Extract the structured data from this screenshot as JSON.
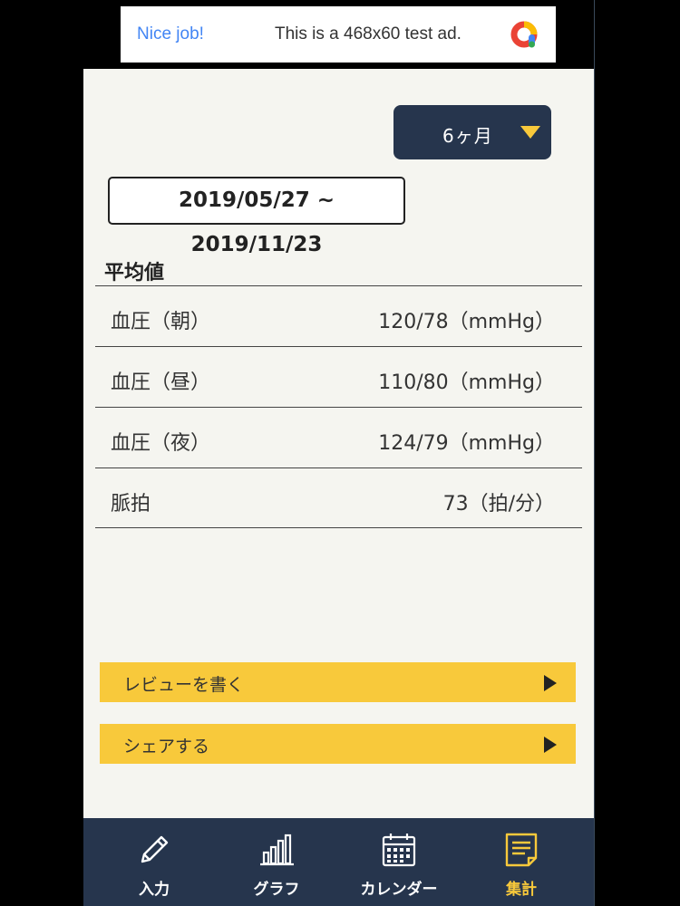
{
  "ad": {
    "title": "Nice job!",
    "text": "This is a 468x60 test ad.",
    "logo_icon": "adsense-logo-icon"
  },
  "period": {
    "selected": "6ヶ月",
    "caret_icon": "triangle-down-icon",
    "caret_color": "#f8c93b"
  },
  "date_range": "2019/05/27 ~ 2019/11/23",
  "averages": {
    "title": "平均値",
    "rows": [
      {
        "label": "血圧（朝）",
        "value": "120/78（mmHg）"
      },
      {
        "label": "血圧（昼）",
        "value": "110/80（mmHg）"
      },
      {
        "label": "血圧（夜）",
        "value": "124/79（mmHg）"
      },
      {
        "label": "脈拍",
        "value": "73（拍/分）"
      }
    ]
  },
  "actions": {
    "review": "レビューを書く",
    "share": "シェアする",
    "arrow_icon": "triangle-right-icon"
  },
  "nav": {
    "items": [
      {
        "label": "入力",
        "icon": "pencil-icon"
      },
      {
        "label": "グラフ",
        "icon": "bar-chart-icon"
      },
      {
        "label": "カレンダー",
        "icon": "calendar-icon"
      },
      {
        "label": "集計",
        "icon": "note-icon",
        "active": true
      }
    ]
  },
  "colors": {
    "navy": "#26354d",
    "accent": "#f8c93b",
    "background": "#f5f5f0"
  }
}
